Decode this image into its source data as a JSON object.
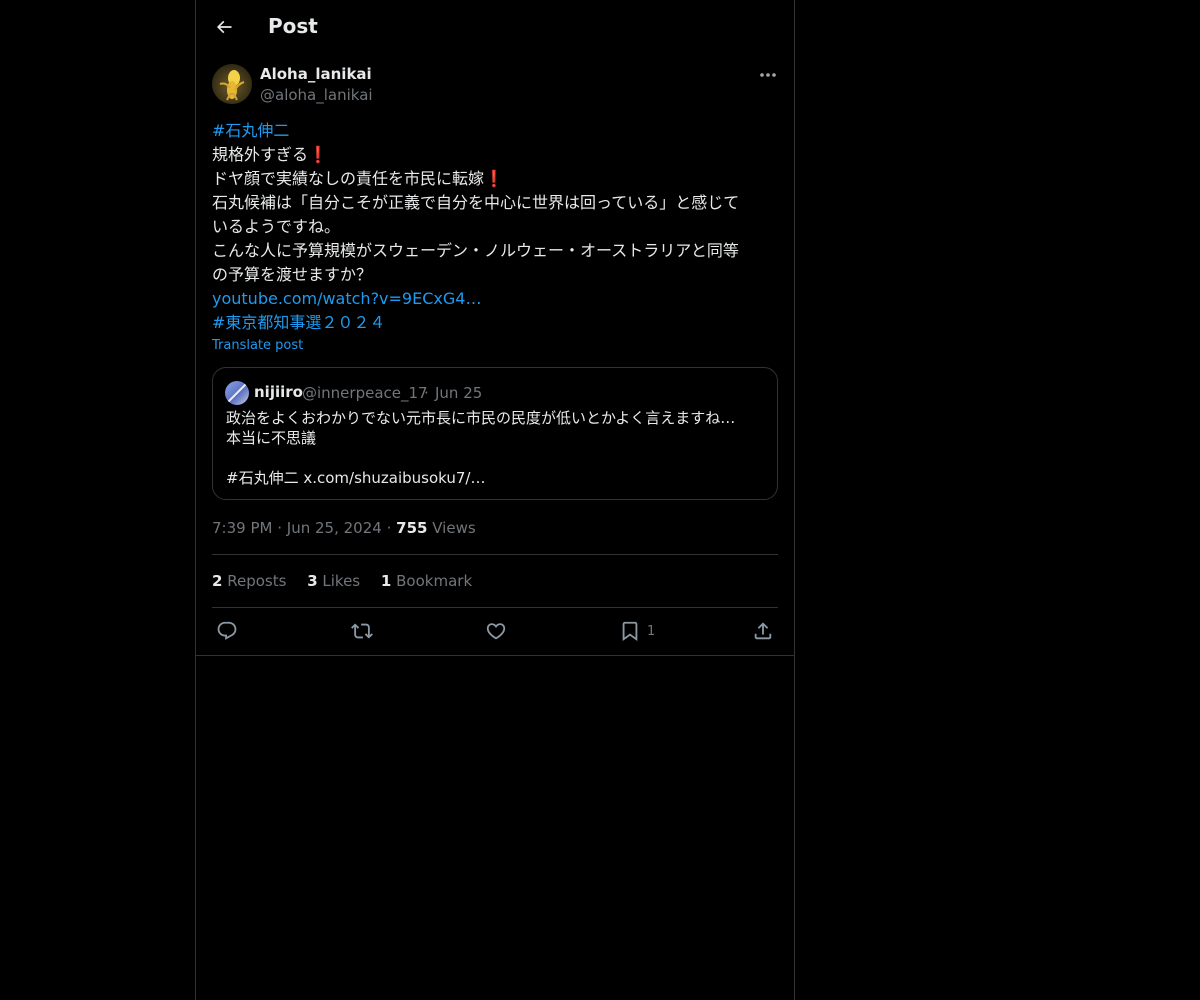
{
  "header": {
    "title": "Post"
  },
  "post": {
    "author": {
      "display_name": "Aloha_lanikai",
      "handle": "@aloha_lanikai"
    },
    "lines": {
      "l1": "#石丸伸二",
      "l2": "規格外すぎる",
      "l3": "ドヤ顔で実績なしの責任を市民に転嫁",
      "l4": "石丸候補は「自分こそが正義で自分を中心に世界は回っている」と感じて",
      "l5": "いるようですね。",
      "l6": "こんな人に予算規模がスウェーデン・ノルウェー・オーストラリアと同等",
      "l7": "の予算を渡せますか？",
      "l8": "youtube.com/watch?v=9ECxG4…",
      "l9": "#東京都知事選２０２４"
    },
    "emoji_exclamation": "❗",
    "translate_label": "Translate post",
    "quote": {
      "display_name": "nijiiro",
      "handle": "@innerpeace_17",
      "separator": "·",
      "date": "Jun 25",
      "line1": "政治をよくおわかりでない元市長に市民の民度が低いとかよく言えますね…",
      "line2": "本当に不思議",
      "line3": "",
      "line4": "#石丸伸二 x.com/shuzaibusoku7/…"
    },
    "meta": {
      "time": "7:39 PM",
      "separator": "·",
      "date": "Jun 25, 2024",
      "views_count": "755",
      "views_label": "Views"
    },
    "stats": {
      "reposts_count": "2",
      "reposts_label": "Reposts",
      "likes_count": "3",
      "likes_label": "Likes",
      "bookmarks_count": "1",
      "bookmarks_label": "Bookmark"
    },
    "actions": {
      "reply_icon": "reply-icon",
      "repost_icon": "repost-icon",
      "like_icon": "heart-icon",
      "bookmark_icon": "bookmark-icon",
      "bookmark_count": "1",
      "share_icon": "share-icon"
    }
  },
  "colors": {
    "background": "#000000",
    "text": "#e7e9ea",
    "muted": "#71767b",
    "link": "#1d9bf0",
    "border": "#2f3336",
    "exclamation": "#dd2e44"
  }
}
